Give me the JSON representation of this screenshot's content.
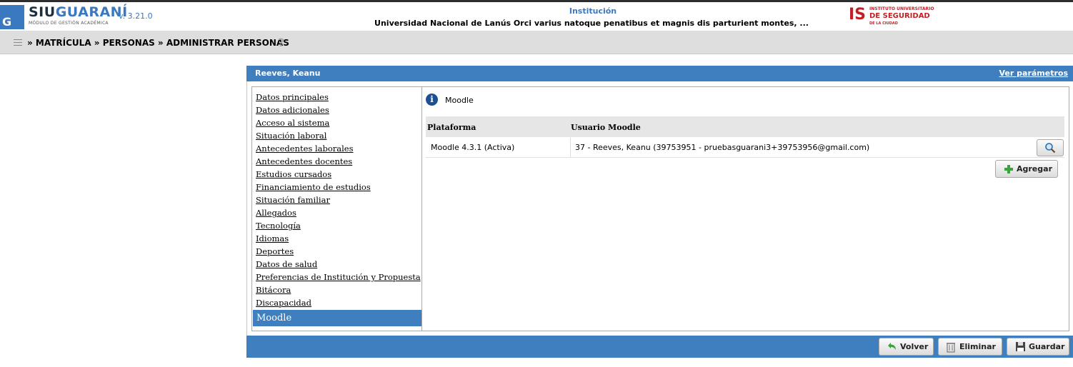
{
  "app": {
    "logo_siu": "SIU",
    "logo_guarani": "GUARANÍ",
    "logo_subtitle": "MÓDULO DE GESTIÓN ACADÉMICA",
    "logo_mark": "G",
    "version": "v. 3.21.0"
  },
  "institution": {
    "label": "Institución",
    "name": "Universidad Nacional de Lanús Orci varius natoque penatibus et magnis dis parturient montes, ...",
    "logo_mark": "IS",
    "logo_line1": "INSTITUTO UNIVERSITARIO",
    "logo_line2": "DE SEGURIDAD",
    "logo_line3": "DE LA CIUDAD"
  },
  "breadcrumb": "» MATRÍCULA » PERSONAS » ADMINISTRAR PERSONAS",
  "help_glyph": "?",
  "panel": {
    "title": "Reeves, Keanu",
    "params_link": "Ver parámetros"
  },
  "sidebar": {
    "items": [
      {
        "label": "Datos principales"
      },
      {
        "label": "Datos adicionales"
      },
      {
        "label": "Acceso al sistema"
      },
      {
        "label": "Situación laboral"
      },
      {
        "label": "Antecedentes laborales"
      },
      {
        "label": "Antecedentes docentes"
      },
      {
        "label": "Estudios cursados"
      },
      {
        "label": "Financiamiento de estudios"
      },
      {
        "label": "Situación familiar"
      },
      {
        "label": "Allegados"
      },
      {
        "label": "Tecnología"
      },
      {
        "label": "Idiomas"
      },
      {
        "label": "Deportes"
      },
      {
        "label": "Datos de salud"
      },
      {
        "label": "Preferencias de Institución y Propuesta"
      },
      {
        "label": "Bitácora"
      },
      {
        "label": "Discapacidad"
      }
    ],
    "active": "Moodle"
  },
  "content": {
    "section_title": "Moodle",
    "info_glyph": "i",
    "table": {
      "headers": [
        "Plataforma",
        "Usuario Moodle"
      ],
      "rows": [
        [
          "Moodle 4.3.1 (Activa)",
          "37 - Reeves, Keanu (39753951 - pruebasguarani3+39753956@gmail.com)"
        ]
      ]
    },
    "add_label": "Agregar"
  },
  "footer": {
    "volver": "Volver",
    "eliminar": "Eliminar",
    "guardar": "Guardar"
  },
  "icons": {
    "search": "search-icon",
    "add": "plus-icon",
    "back": "arrow-back-icon",
    "delete": "trash-icon",
    "save": "floppy-icon"
  },
  "colors": {
    "accent": "#3f7fbf",
    "brand_red": "#c32026"
  }
}
